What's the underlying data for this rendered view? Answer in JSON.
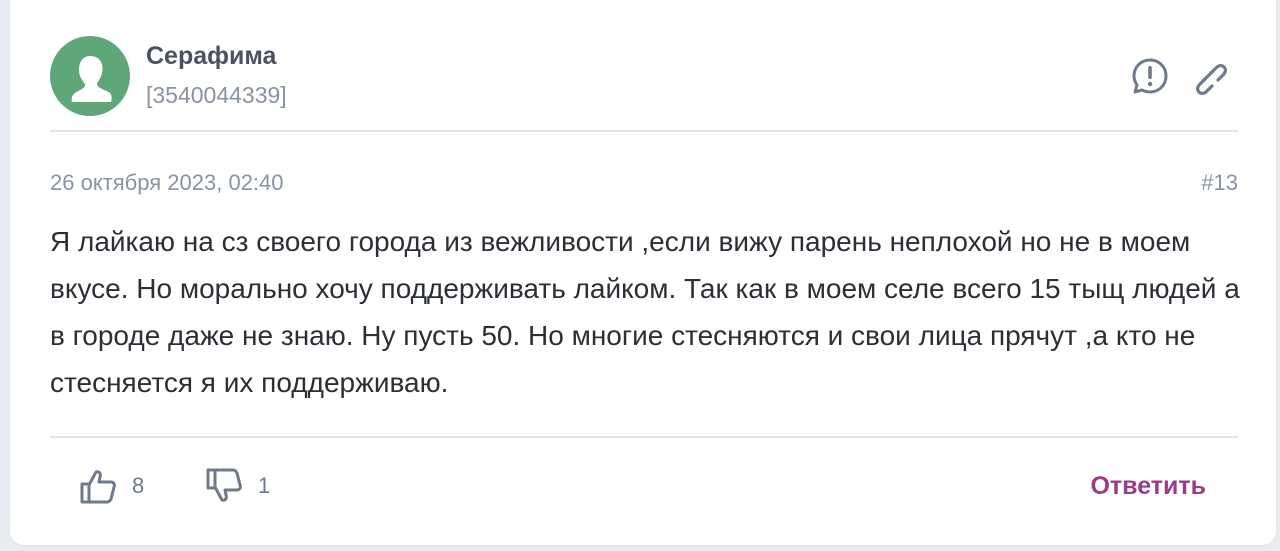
{
  "author": {
    "name": "Серафима",
    "id": "[3540044339]",
    "avatar_icon": "user-silhouette-icon",
    "avatar_color": "#5fa779"
  },
  "header_actions": {
    "report_icon": "exclamation-circle-icon",
    "link_icon": "chain-link-icon"
  },
  "post": {
    "date": "26 октября 2023, 02:40",
    "number": "#13",
    "text": "Я лайкаю на сз своего города из вежливости ,если вижу парень неплохой но не в моем вкусе. Но морально хочу поддерживать лайком. Так как в моем селе всего 15 тыщ людей а в городе даже не знаю. Ну пусть 50. Но многие стесняются и свои лица прячут ,а кто не стесняется я их поддерживаю."
  },
  "footer": {
    "likes": "8",
    "dislikes": "1",
    "like_icon": "thumbs-up-icon",
    "dislike_icon": "thumbs-down-icon",
    "reply_label": "Ответить",
    "reply_color": "#9a3b84"
  }
}
